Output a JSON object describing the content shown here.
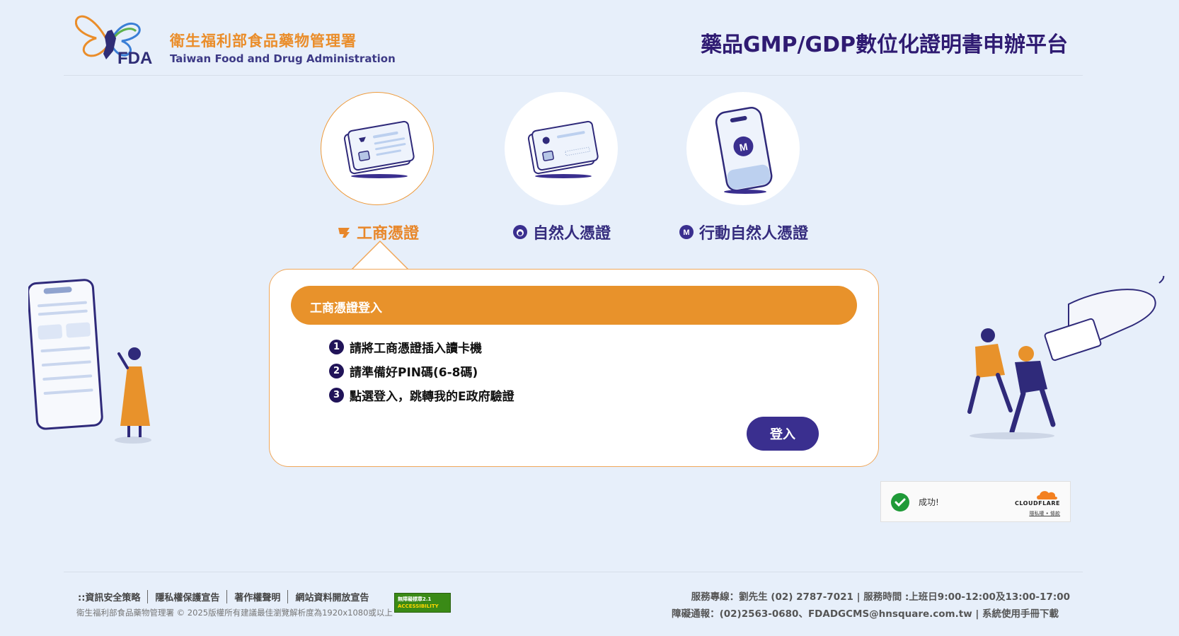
{
  "header": {
    "org_name_zh": "衛生福利部食品藥物管理署",
    "org_name_en": "Taiwan Food and Drug Administration",
    "logo_text": "FDA",
    "platform_title": "藥品GMP/GDP數位化證明書申辦平台"
  },
  "methods": [
    {
      "label": "工商憑證",
      "icon": "business-certificate-card-icon",
      "active": true
    },
    {
      "label": "自然人憑證",
      "icon": "citizen-certificate-card-icon",
      "active": false
    },
    {
      "label": "行動自然人憑證",
      "icon": "mobile-citizen-certificate-phone-icon",
      "active": false
    }
  ],
  "login_card": {
    "title": "工商憑證登入",
    "steps": [
      {
        "num": "1",
        "text": "請將工商憑證插入讀卡機"
      },
      {
        "num": "2",
        "text": "請準備好PIN碼(6-8碼)"
      },
      {
        "num": "3",
        "text": "點選登入，跳轉我的E政府驗證"
      }
    ],
    "login_label": "登入"
  },
  "captcha": {
    "status": "成功!",
    "brand": "CLOUDFLARE",
    "links": "隱私權 • 條款"
  },
  "footer": {
    "links": [
      "::資訊安全策略",
      "隱私權保護宣告",
      "著作權聲明",
      "網站資料開放宣告"
    ],
    "copyright": "衛生福利部食品藥物管理署 © 2025版權所有建議最佳瀏覽解析度為1920x1080或以上",
    "a11y_badge_line1": "無障礙標章2.1",
    "a11y_badge_line2": "ACCESSIBILITY",
    "service_line": "服務專線：劉先生 (02) 2787-7021 | 服務時間 :上班日9:00-12:00及13:00-17:00",
    "contact_line": "障礙通報：(02)2563-0680、FDADGCMS@hnsquare.com.tw | 系統使用手冊下載"
  },
  "colors": {
    "background": "#e7effa",
    "accent_orange": "#e8922b",
    "primary_purple": "#3a2f8f",
    "title_purple": "#2f1b72"
  }
}
